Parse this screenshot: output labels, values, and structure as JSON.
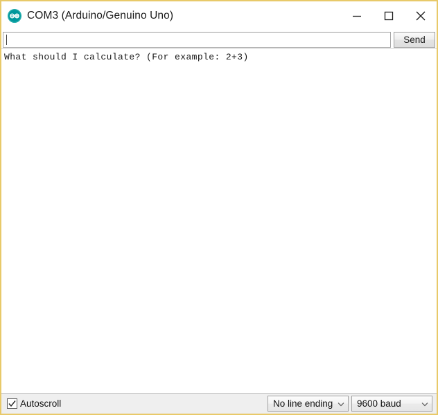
{
  "window": {
    "title": "COM3 (Arduino/Genuino Uno)",
    "app_icon": "arduino-logo-icon",
    "border_color": "#e8c969",
    "controls": {
      "minimize_label": "Minimize",
      "minimize_icon": "minimize-icon",
      "maximize_label": "Maximize",
      "maximize_icon": "maximize-icon",
      "close_label": "Close",
      "close_icon": "close-icon"
    }
  },
  "send_row": {
    "input_value": "",
    "input_placeholder": "",
    "send_label": "Send"
  },
  "console": {
    "lines": [
      "What should I calculate? (For example: 2+3)"
    ],
    "text": "What should I calculate? (For example: 2+3)"
  },
  "statusbar": {
    "autoscroll_label": "Autoscroll",
    "autoscroll_checked": true,
    "checkmark_icon": "checkmark-icon",
    "line_ending": {
      "selected": "No line ending",
      "arrow_icon": "chevron-down-icon"
    },
    "baud_rate": {
      "selected": "9600 baud",
      "arrow_icon": "chevron-down-icon"
    }
  },
  "colors": {
    "accent": "#00979c",
    "window_border": "#e8c969",
    "statusbar_bg": "#efefef",
    "console_text": "#161616"
  }
}
